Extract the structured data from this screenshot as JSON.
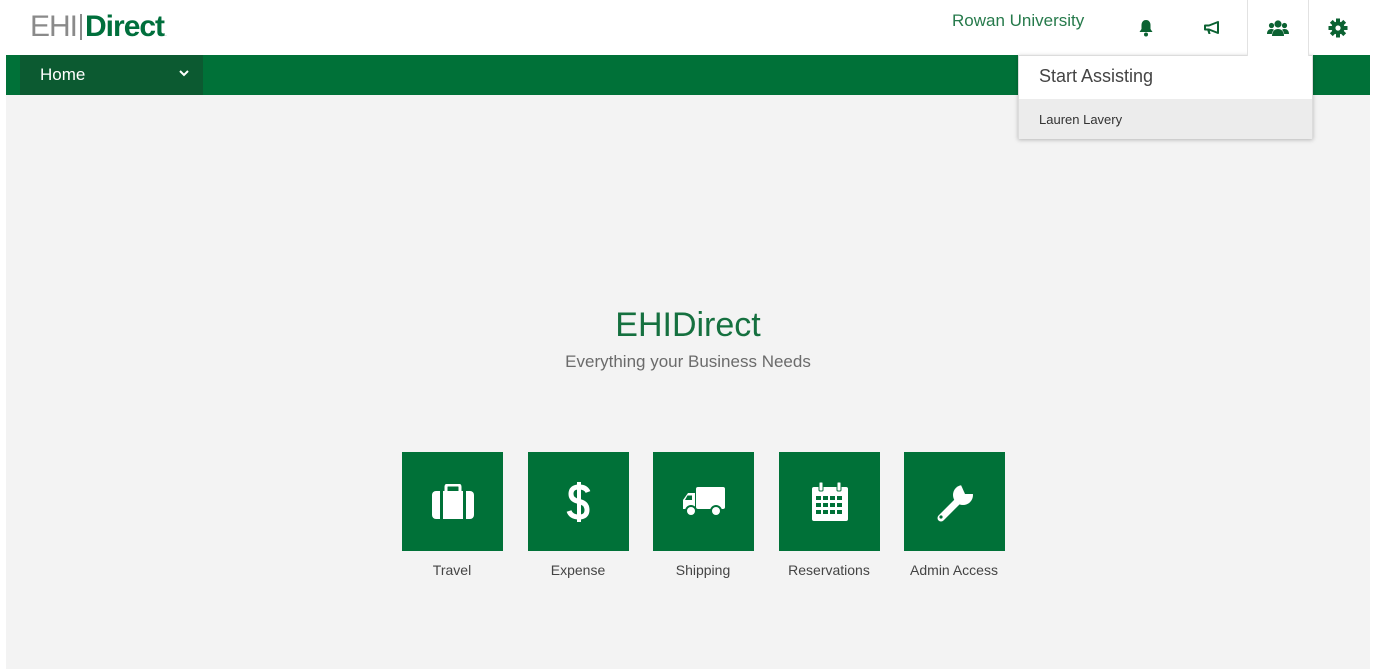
{
  "header": {
    "logo": {
      "part1": "EHI",
      "part2": "Direct",
      "tm": "."
    },
    "organization": "Rowan University",
    "icons": [
      "bell-icon",
      "megaphone-icon",
      "users-icon",
      "gear-icon"
    ]
  },
  "nav": {
    "home_label": "Home"
  },
  "hero": {
    "title": "EHIDirect",
    "subtitle": "Everything your Business Needs"
  },
  "tiles": [
    {
      "label": "Travel",
      "icon": "suitcase-icon"
    },
    {
      "label": "Expense",
      "icon": "dollar-icon"
    },
    {
      "label": "Shipping",
      "icon": "truck-icon"
    },
    {
      "label": "Reservations",
      "icon": "calendar-icon"
    },
    {
      "label": "Admin Access",
      "icon": "wrench-icon"
    }
  ],
  "assist_menu": {
    "title": "Start Assisting",
    "items": [
      "Lauren Lavery"
    ]
  },
  "colors": {
    "brand_green": "#007138",
    "dark_green": "#0c5a31",
    "text_green": "#267a4b",
    "background": "#f3f3f3"
  }
}
